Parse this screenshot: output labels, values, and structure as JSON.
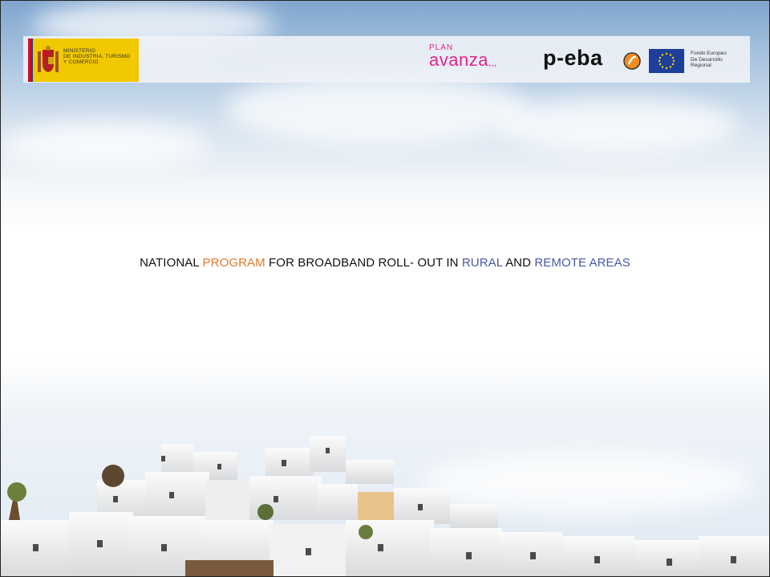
{
  "header": {
    "ministry_lines": [
      "MINISTERIO",
      "DE INDUSTRIA, TURISMO",
      "Y COMERCIO"
    ],
    "plan_small": "PLAN",
    "plan_large": "avanza",
    "plan_dots": ",,,",
    "peba_label": "p-eba",
    "eu_lines": [
      "Fondo Europeo",
      "De Desarrollo",
      "Regional"
    ]
  },
  "title": {
    "part1": "NATIONAL ",
    "part2": "PROGRAM",
    "part3": " FOR BROADBAND ROLL- OUT IN ",
    "part4": "RURAL",
    "part5": " AND ",
    "part6": "REMOTE AREAS"
  },
  "colors": {
    "accent_orange": "#e57a2a",
    "accent_blue": "#4a57a8",
    "ministry_yellow": "#f2c800",
    "plan_pink": "#e2238a",
    "eu_blue": "#1d3f9a"
  }
}
